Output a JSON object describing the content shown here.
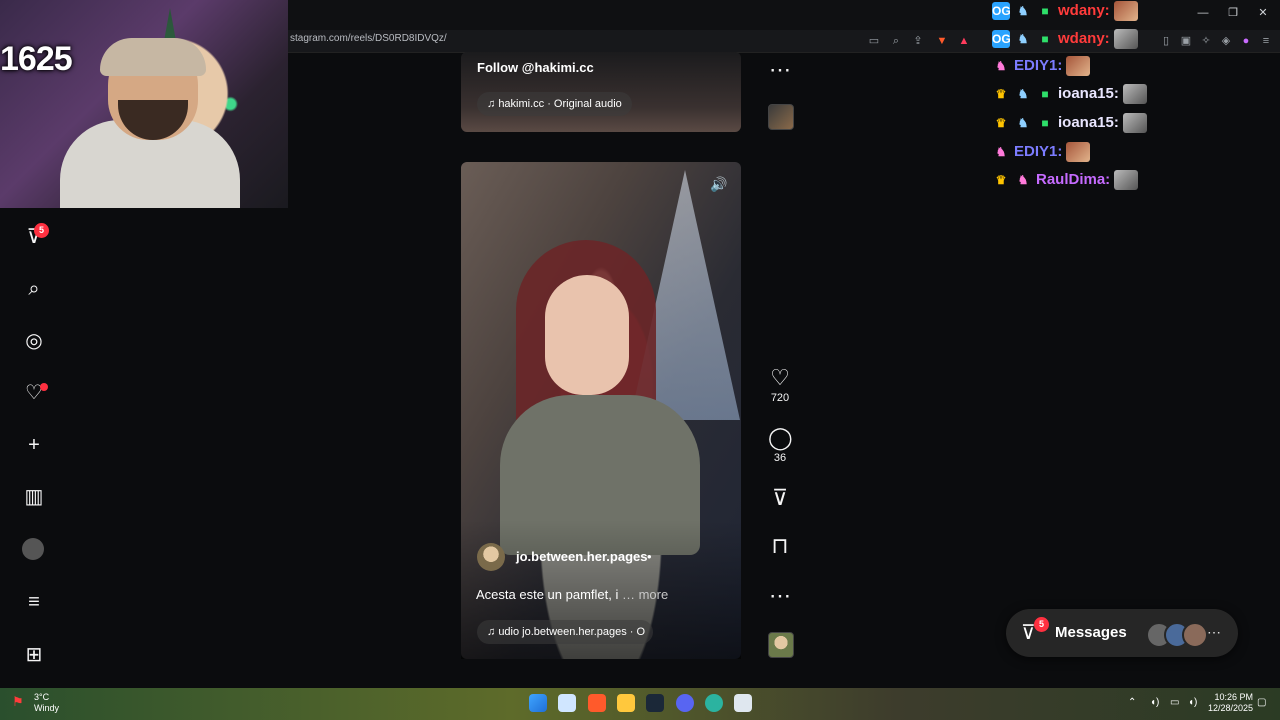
{
  "browser": {
    "url": "stagram.com/reels/DS0RD8IDVQz/"
  },
  "webcam": {
    "overlay_number": "1625"
  },
  "nav": {
    "notifications_badge": "5"
  },
  "reel_top": {
    "follow_text": "Follow @hakimi.cc",
    "audio_text": "hakimi.cc · Original audio"
  },
  "reel_main": {
    "username": "jo.between.her.pages",
    "separator": "•",
    "caption": "Acesta este un pamflet, i",
    "more_label": "… more",
    "audio_text": "udio  jo.between.her.pages · O"
  },
  "actions": {
    "likes": "720",
    "comments": "36"
  },
  "chat": {
    "lines": [
      {
        "user": "wdany:",
        "color": "#ff3b3b"
      },
      {
        "user": "wdany:",
        "color": "#ff3b3b"
      },
      {
        "user": "EDIY1:",
        "color": "#7c7cff"
      },
      {
        "user": "ioana15:",
        "color": "#e9e6ff"
      },
      {
        "user": "ioana15:",
        "color": "#e9e6ff"
      },
      {
        "user": "EDIY1:",
        "color": "#7c7cff"
      },
      {
        "user": "RaulDima:",
        "color": "#c66bff"
      }
    ]
  },
  "messages": {
    "label": "Messages",
    "badge": "5"
  },
  "taskbar": {
    "weather_temp": "3°C",
    "weather_desc": "Windy",
    "time": "10:26 PM",
    "date": "12/28/2025"
  }
}
